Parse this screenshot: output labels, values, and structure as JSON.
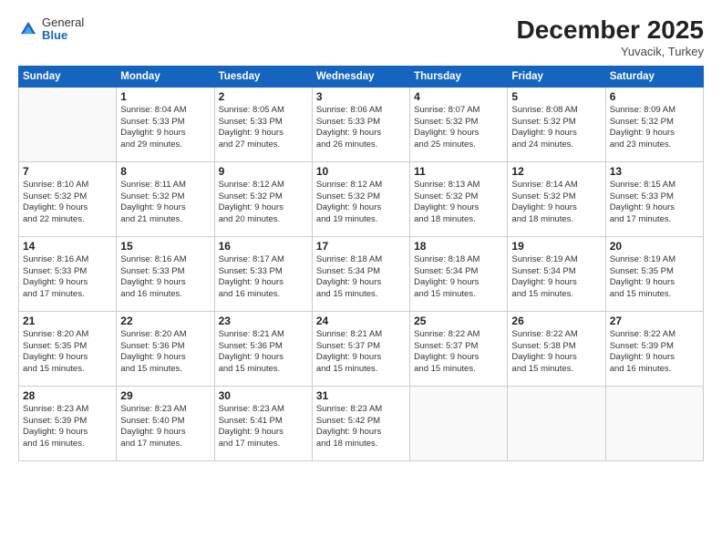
{
  "logo": {
    "general": "General",
    "blue": "Blue"
  },
  "title": "December 2025",
  "location": "Yuvacik, Turkey",
  "days_of_week": [
    "Sunday",
    "Monday",
    "Tuesday",
    "Wednesday",
    "Thursday",
    "Friday",
    "Saturday"
  ],
  "weeks": [
    [
      {
        "day": "",
        "lines": []
      },
      {
        "day": "1",
        "lines": [
          "Sunrise: 8:04 AM",
          "Sunset: 5:33 PM",
          "Daylight: 9 hours",
          "and 29 minutes."
        ]
      },
      {
        "day": "2",
        "lines": [
          "Sunrise: 8:05 AM",
          "Sunset: 5:33 PM",
          "Daylight: 9 hours",
          "and 27 minutes."
        ]
      },
      {
        "day": "3",
        "lines": [
          "Sunrise: 8:06 AM",
          "Sunset: 5:33 PM",
          "Daylight: 9 hours",
          "and 26 minutes."
        ]
      },
      {
        "day": "4",
        "lines": [
          "Sunrise: 8:07 AM",
          "Sunset: 5:32 PM",
          "Daylight: 9 hours",
          "and 25 minutes."
        ]
      },
      {
        "day": "5",
        "lines": [
          "Sunrise: 8:08 AM",
          "Sunset: 5:32 PM",
          "Daylight: 9 hours",
          "and 24 minutes."
        ]
      },
      {
        "day": "6",
        "lines": [
          "Sunrise: 8:09 AM",
          "Sunset: 5:32 PM",
          "Daylight: 9 hours",
          "and 23 minutes."
        ]
      }
    ],
    [
      {
        "day": "7",
        "lines": [
          "Sunrise: 8:10 AM",
          "Sunset: 5:32 PM",
          "Daylight: 9 hours",
          "and 22 minutes."
        ]
      },
      {
        "day": "8",
        "lines": [
          "Sunrise: 8:11 AM",
          "Sunset: 5:32 PM",
          "Daylight: 9 hours",
          "and 21 minutes."
        ]
      },
      {
        "day": "9",
        "lines": [
          "Sunrise: 8:12 AM",
          "Sunset: 5:32 PM",
          "Daylight: 9 hours",
          "and 20 minutes."
        ]
      },
      {
        "day": "10",
        "lines": [
          "Sunrise: 8:12 AM",
          "Sunset: 5:32 PM",
          "Daylight: 9 hours",
          "and 19 minutes."
        ]
      },
      {
        "day": "11",
        "lines": [
          "Sunrise: 8:13 AM",
          "Sunset: 5:32 PM",
          "Daylight: 9 hours",
          "and 18 minutes."
        ]
      },
      {
        "day": "12",
        "lines": [
          "Sunrise: 8:14 AM",
          "Sunset: 5:32 PM",
          "Daylight: 9 hours",
          "and 18 minutes."
        ]
      },
      {
        "day": "13",
        "lines": [
          "Sunrise: 8:15 AM",
          "Sunset: 5:33 PM",
          "Daylight: 9 hours",
          "and 17 minutes."
        ]
      }
    ],
    [
      {
        "day": "14",
        "lines": [
          "Sunrise: 8:16 AM",
          "Sunset: 5:33 PM",
          "Daylight: 9 hours",
          "and 17 minutes."
        ]
      },
      {
        "day": "15",
        "lines": [
          "Sunrise: 8:16 AM",
          "Sunset: 5:33 PM",
          "Daylight: 9 hours",
          "and 16 minutes."
        ]
      },
      {
        "day": "16",
        "lines": [
          "Sunrise: 8:17 AM",
          "Sunset: 5:33 PM",
          "Daylight: 9 hours",
          "and 16 minutes."
        ]
      },
      {
        "day": "17",
        "lines": [
          "Sunrise: 8:18 AM",
          "Sunset: 5:34 PM",
          "Daylight: 9 hours",
          "and 15 minutes."
        ]
      },
      {
        "day": "18",
        "lines": [
          "Sunrise: 8:18 AM",
          "Sunset: 5:34 PM",
          "Daylight: 9 hours",
          "and 15 minutes."
        ]
      },
      {
        "day": "19",
        "lines": [
          "Sunrise: 8:19 AM",
          "Sunset: 5:34 PM",
          "Daylight: 9 hours",
          "and 15 minutes."
        ]
      },
      {
        "day": "20",
        "lines": [
          "Sunrise: 8:19 AM",
          "Sunset: 5:35 PM",
          "Daylight: 9 hours",
          "and 15 minutes."
        ]
      }
    ],
    [
      {
        "day": "21",
        "lines": [
          "Sunrise: 8:20 AM",
          "Sunset: 5:35 PM",
          "Daylight: 9 hours",
          "and 15 minutes."
        ]
      },
      {
        "day": "22",
        "lines": [
          "Sunrise: 8:20 AM",
          "Sunset: 5:36 PM",
          "Daylight: 9 hours",
          "and 15 minutes."
        ]
      },
      {
        "day": "23",
        "lines": [
          "Sunrise: 8:21 AM",
          "Sunset: 5:36 PM",
          "Daylight: 9 hours",
          "and 15 minutes."
        ]
      },
      {
        "day": "24",
        "lines": [
          "Sunrise: 8:21 AM",
          "Sunset: 5:37 PM",
          "Daylight: 9 hours",
          "and 15 minutes."
        ]
      },
      {
        "day": "25",
        "lines": [
          "Sunrise: 8:22 AM",
          "Sunset: 5:37 PM",
          "Daylight: 9 hours",
          "and 15 minutes."
        ]
      },
      {
        "day": "26",
        "lines": [
          "Sunrise: 8:22 AM",
          "Sunset: 5:38 PM",
          "Daylight: 9 hours",
          "and 15 minutes."
        ]
      },
      {
        "day": "27",
        "lines": [
          "Sunrise: 8:22 AM",
          "Sunset: 5:39 PM",
          "Daylight: 9 hours",
          "and 16 minutes."
        ]
      }
    ],
    [
      {
        "day": "28",
        "lines": [
          "Sunrise: 8:23 AM",
          "Sunset: 5:39 PM",
          "Daylight: 9 hours",
          "and 16 minutes."
        ]
      },
      {
        "day": "29",
        "lines": [
          "Sunrise: 8:23 AM",
          "Sunset: 5:40 PM",
          "Daylight: 9 hours",
          "and 17 minutes."
        ]
      },
      {
        "day": "30",
        "lines": [
          "Sunrise: 8:23 AM",
          "Sunset: 5:41 PM",
          "Daylight: 9 hours",
          "and 17 minutes."
        ]
      },
      {
        "day": "31",
        "lines": [
          "Sunrise: 8:23 AM",
          "Sunset: 5:42 PM",
          "Daylight: 9 hours",
          "and 18 minutes."
        ]
      },
      {
        "day": "",
        "lines": []
      },
      {
        "day": "",
        "lines": []
      },
      {
        "day": "",
        "lines": []
      }
    ]
  ]
}
